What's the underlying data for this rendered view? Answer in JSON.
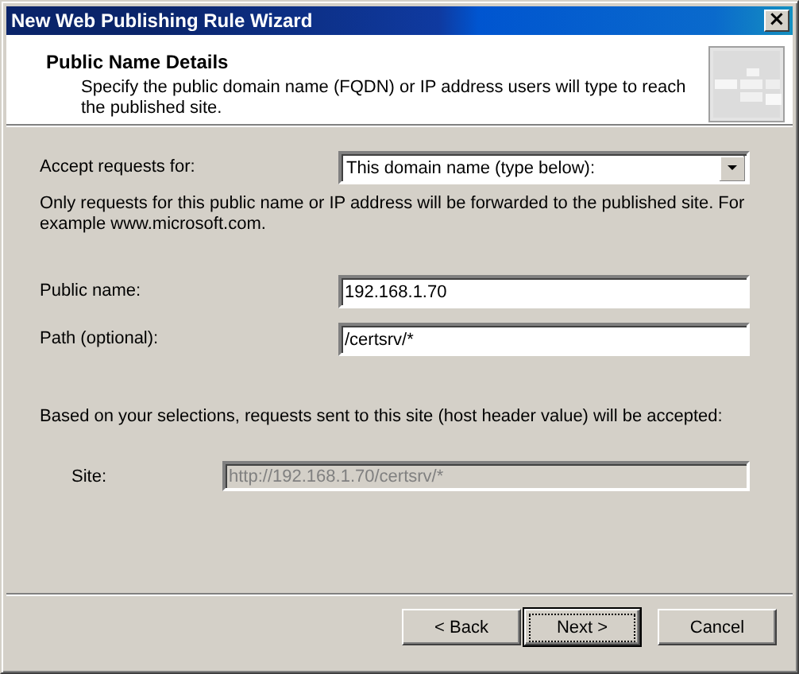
{
  "window": {
    "title": "New Web Publishing Rule Wizard",
    "close_button": "×"
  },
  "header": {
    "title": "Public Name Details",
    "subtitle": "Specify the public domain name (FQDN) or IP address users will type to reach the published site."
  },
  "accept": {
    "label": "Accept requests for:",
    "value": "This domain name (type below):"
  },
  "note": "Only requests for this public name or IP address will be forwarded to the published site. For example www.microsoft.com.",
  "fields": [
    {
      "label": "Public name:",
      "value": "192.168.1.70",
      "disabled": false
    },
    {
      "label": "Path (optional):",
      "value": "/certsrv/*",
      "disabled": false
    }
  ],
  "result_text": "Based on your selections, requests sent to this site (host header value) will be accepted:",
  "site": {
    "label": "Site:",
    "value": "http://192.168.1.70/certsrv/*",
    "disabled": true
  },
  "buttons": [
    {
      "label": "< Back",
      "default": false
    },
    {
      "label": "Next >",
      "default": true
    },
    {
      "label": "Cancel",
      "default": false
    }
  ]
}
